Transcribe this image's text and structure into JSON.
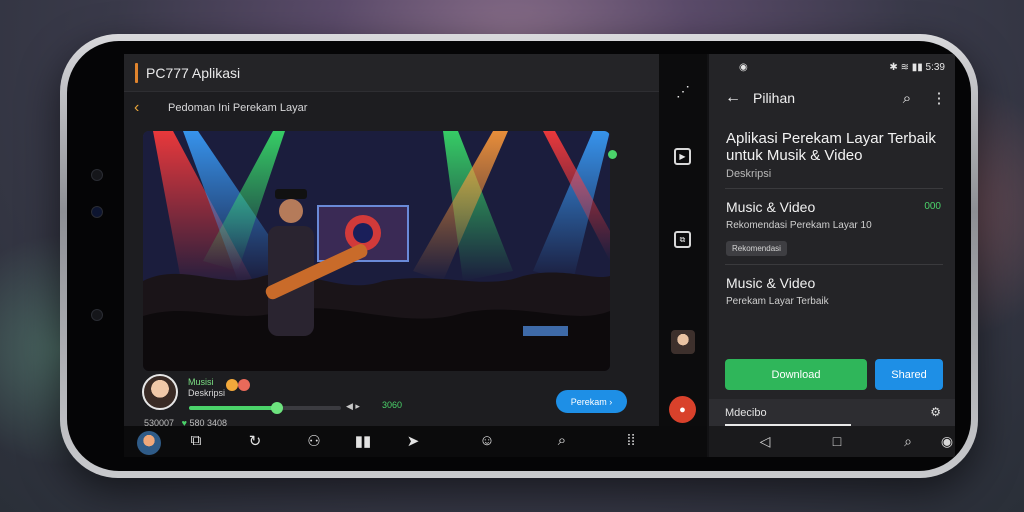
{
  "window": {
    "app_title": "PC777 Aplikasi"
  },
  "left_panel": {
    "nav_title": "Pedoman Ini Perekam Layar",
    "back_icon": "chevron-left-icon",
    "artist": {
      "name": "Musisi",
      "subtitle": "Deskripsi"
    },
    "progress": 0.58,
    "time": "3060",
    "action_button": "Perekam ›",
    "stats": {
      "a": "530007",
      "b": "580",
      "c": "3408"
    }
  },
  "rail": {
    "icons": [
      "share-icon",
      "play-box-icon",
      "copy-icon",
      "avatar",
      "record-icon"
    ]
  },
  "right_panel": {
    "status": {
      "left": "◉",
      "right": "5:39"
    },
    "header_title": "Pilihan",
    "title": "Aplikasi Perekam Layar Terbaik untuk Musik & Video",
    "subtitle": "Deskripsi",
    "section1": {
      "title": "Music & Video",
      "downloads": "000",
      "desc": "Rekomendasi Perekam Layar 10",
      "chip": "Rekomendasi"
    },
    "section2": {
      "title": "Music & Video",
      "desc": "Perekam Layar Terbaik"
    },
    "btn_download": "Download",
    "btn_shared": "Shared",
    "footer": "Mdecibo"
  },
  "colors": {
    "accent_green": "#2fb65a",
    "accent_blue": "#1e8fe6",
    "accent_orange": "#e0842d"
  }
}
